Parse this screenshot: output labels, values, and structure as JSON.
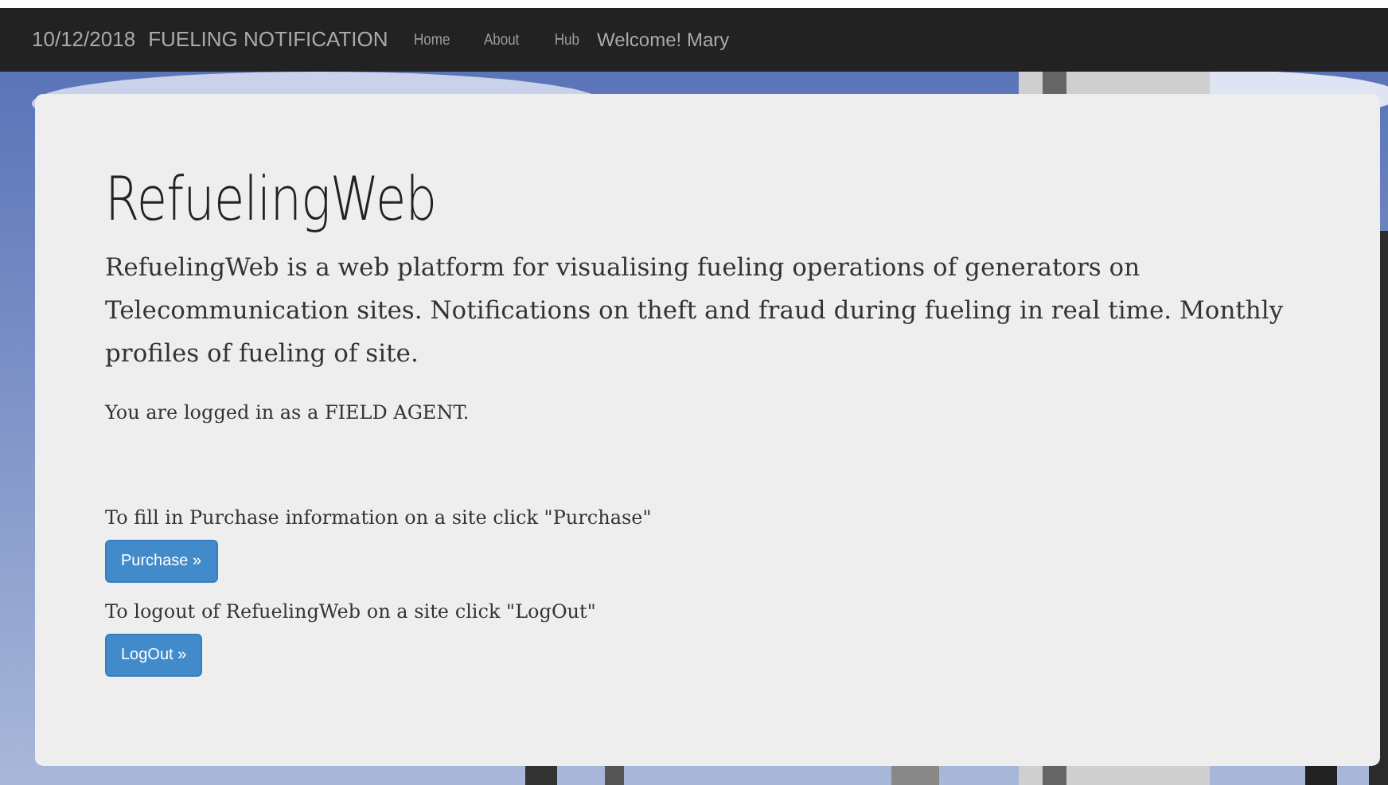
{
  "navbar": {
    "date": "10/12/2018",
    "brand": "FUELING NOTIFICATION",
    "links": [
      "Home",
      "About",
      "Hub"
    ],
    "welcome": "Welcome! Mary"
  },
  "jumbotron": {
    "title": "RefuelingWeb",
    "lead": "RefuelingWeb is a web platform for visualising fueling operations of generators on Telecommunication sites. Notifications on theft and fraud during fueling in real time. Monthly profiles of fueling of site.",
    "role_note": "You are logged in as a FIELD AGENT.",
    "actions": [
      {
        "text": "To fill in Purchase information on a site click \"Purchase\"",
        "button": "Purchase »"
      },
      {
        "text": "To logout of RefuelingWeb on a site click \"LogOut\"",
        "button": "LogOut »"
      }
    ]
  }
}
